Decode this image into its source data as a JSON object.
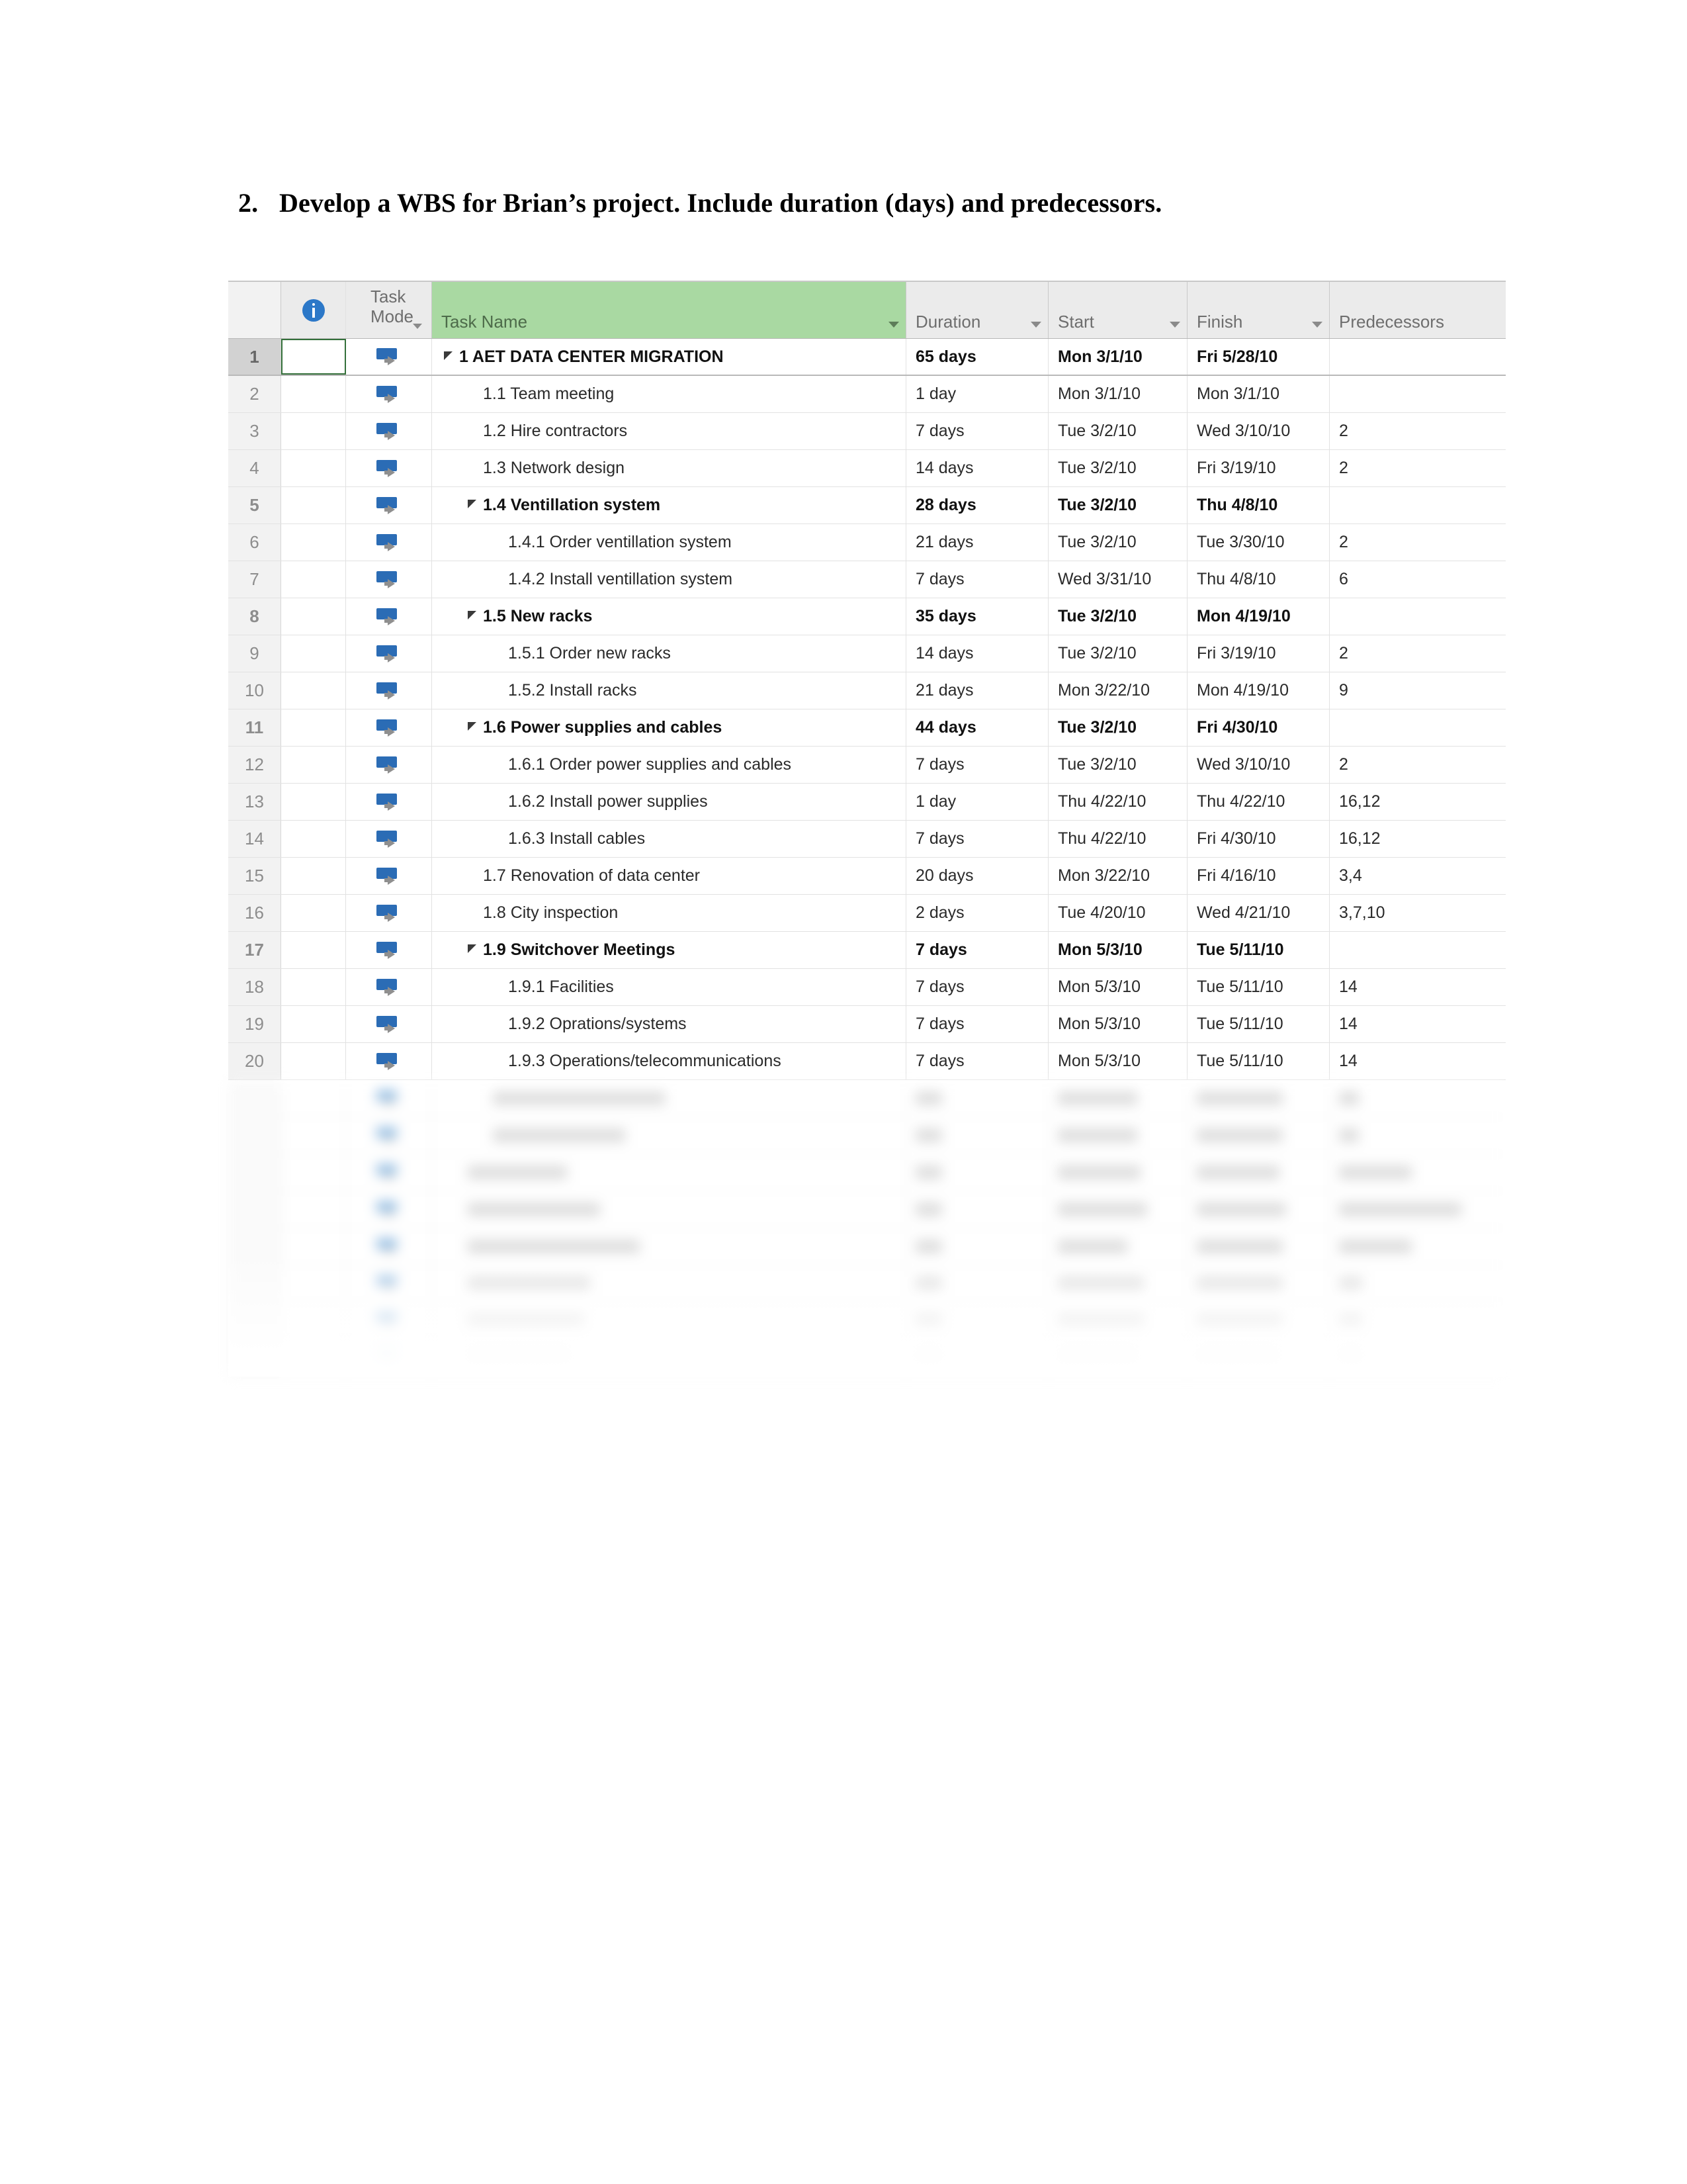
{
  "question": {
    "number": "2.",
    "text": "Develop a WBS for Brian’s project. Include duration (days) and predecessors."
  },
  "grid": {
    "columns": {
      "row_number": "",
      "indicator_icon": "info-icon",
      "task_mode": "Task\nMode",
      "task_name": "Task Name",
      "duration": "Duration",
      "start": "Start",
      "finish": "Finish",
      "predecessors": "Predecessors"
    },
    "accent_colors": {
      "task_name_header": "#a9d9a2",
      "header_background": "#ebebeb",
      "selection_border": "#34703a",
      "task_mode_icon": "#2b6cb5",
      "info_icon": "#2c78c8"
    },
    "rows": [
      {
        "id": "1",
        "mode_icon": "auto-scheduled-icon",
        "name": "1 AET DATA CENTER MIGRATION",
        "duration": "65 days",
        "start": "Mon 3/1/10",
        "finish": "Fri 5/28/10",
        "predecessors": "",
        "level": 1,
        "summary": true,
        "selected": true
      },
      {
        "id": "2",
        "mode_icon": "auto-scheduled-icon",
        "name": "1.1 Team meeting",
        "duration": "1 day",
        "start": "Mon 3/1/10",
        "finish": "Mon 3/1/10",
        "predecessors": "",
        "level": 2,
        "summary": false,
        "selected": false
      },
      {
        "id": "3",
        "mode_icon": "auto-scheduled-icon",
        "name": "1.2 Hire contractors",
        "duration": "7 days",
        "start": "Tue 3/2/10",
        "finish": "Wed 3/10/10",
        "predecessors": "2",
        "level": 2,
        "summary": false,
        "selected": false
      },
      {
        "id": "4",
        "mode_icon": "auto-scheduled-icon",
        "name": "1.3 Network design",
        "duration": "14 days",
        "start": "Tue 3/2/10",
        "finish": "Fri 3/19/10",
        "predecessors": "2",
        "level": 2,
        "summary": false,
        "selected": false
      },
      {
        "id": "5",
        "mode_icon": "auto-scheduled-icon",
        "name": "1.4 Ventillation system",
        "duration": "28 days",
        "start": "Tue 3/2/10",
        "finish": "Thu 4/8/10",
        "predecessors": "",
        "level": 2,
        "summary": true,
        "selected": false
      },
      {
        "id": "6",
        "mode_icon": "auto-scheduled-icon",
        "name": "1.4.1 Order ventillation system",
        "duration": "21 days",
        "start": "Tue 3/2/10",
        "finish": "Tue 3/30/10",
        "predecessors": "2",
        "level": 3,
        "summary": false,
        "selected": false
      },
      {
        "id": "7",
        "mode_icon": "auto-scheduled-icon",
        "name": "1.4.2 Install ventillation system",
        "duration": "7 days",
        "start": "Wed 3/31/10",
        "finish": "Thu 4/8/10",
        "predecessors": "6",
        "level": 3,
        "summary": false,
        "selected": false
      },
      {
        "id": "8",
        "mode_icon": "auto-scheduled-icon",
        "name": "1.5 New racks",
        "duration": "35 days",
        "start": "Tue 3/2/10",
        "finish": "Mon 4/19/10",
        "predecessors": "",
        "level": 2,
        "summary": true,
        "selected": false
      },
      {
        "id": "9",
        "mode_icon": "auto-scheduled-icon",
        "name": "1.5.1 Order new racks",
        "duration": "14 days",
        "start": "Tue 3/2/10",
        "finish": "Fri 3/19/10",
        "predecessors": "2",
        "level": 3,
        "summary": false,
        "selected": false
      },
      {
        "id": "10",
        "mode_icon": "auto-scheduled-icon",
        "name": "1.5.2 Install racks",
        "duration": "21 days",
        "start": "Mon 3/22/10",
        "finish": "Mon 4/19/10",
        "predecessors": "9",
        "level": 3,
        "summary": false,
        "selected": false
      },
      {
        "id": "11",
        "mode_icon": "auto-scheduled-icon",
        "name": "1.6 Power supplies and cables",
        "duration": "44 days",
        "start": "Tue 3/2/10",
        "finish": "Fri 4/30/10",
        "predecessors": "",
        "level": 2,
        "summary": true,
        "selected": false
      },
      {
        "id": "12",
        "mode_icon": "auto-scheduled-icon",
        "name": "1.6.1 Order power supplies and cables",
        "duration": "7 days",
        "start": "Tue 3/2/10",
        "finish": "Wed 3/10/10",
        "predecessors": "2",
        "level": 3,
        "summary": false,
        "selected": false
      },
      {
        "id": "13",
        "mode_icon": "auto-scheduled-icon",
        "name": "1.6.2 Install power supplies",
        "duration": "1 day",
        "start": "Thu 4/22/10",
        "finish": "Thu 4/22/10",
        "predecessors": "16,12",
        "level": 3,
        "summary": false,
        "selected": false
      },
      {
        "id": "14",
        "mode_icon": "auto-scheduled-icon",
        "name": "1.6.3 Install cables",
        "duration": "7 days",
        "start": "Thu 4/22/10",
        "finish": "Fri 4/30/10",
        "predecessors": "16,12",
        "level": 3,
        "summary": false,
        "selected": false
      },
      {
        "id": "15",
        "mode_icon": "auto-scheduled-icon",
        "name": "1.7 Renovation of data center",
        "duration": "20 days",
        "start": "Mon 3/22/10",
        "finish": "Fri 4/16/10",
        "predecessors": "3,4",
        "level": 2,
        "summary": false,
        "selected": false
      },
      {
        "id": "16",
        "mode_icon": "auto-scheduled-icon",
        "name": "1.8 City inspection",
        "duration": "2 days",
        "start": "Tue 4/20/10",
        "finish": "Wed 4/21/10",
        "predecessors": "3,7,10",
        "level": 2,
        "summary": false,
        "selected": false
      },
      {
        "id": "17",
        "mode_icon": "auto-scheduled-icon",
        "name": "1.9 Switchover Meetings",
        "duration": "7 days",
        "start": "Mon 5/3/10",
        "finish": "Tue 5/11/10",
        "predecessors": "",
        "level": 2,
        "summary": true,
        "selected": false
      },
      {
        "id": "18",
        "mode_icon": "auto-scheduled-icon",
        "name": "1.9.1 Facilities",
        "duration": "7 days",
        "start": "Mon 5/3/10",
        "finish": "Tue 5/11/10",
        "predecessors": "14",
        "level": 3,
        "summary": false,
        "selected": false
      },
      {
        "id": "19",
        "mode_icon": "auto-scheduled-icon",
        "name": "1.9.2 Oprations/systems",
        "duration": "7 days",
        "start": "Mon 5/3/10",
        "finish": "Tue 5/11/10",
        "predecessors": "14",
        "level": 3,
        "summary": false,
        "selected": false
      },
      {
        "id": "20",
        "mode_icon": "auto-scheduled-icon",
        "name": "1.9.3 Operations/telecommunications",
        "duration": "7 days",
        "start": "Mon 5/3/10",
        "finish": "Tue 5/11/10",
        "predecessors": "14",
        "level": 3,
        "summary": false,
        "selected": false
      }
    ],
    "obscured_rows_note": "8 additional rows below are blurred and illegible in the source image"
  }
}
